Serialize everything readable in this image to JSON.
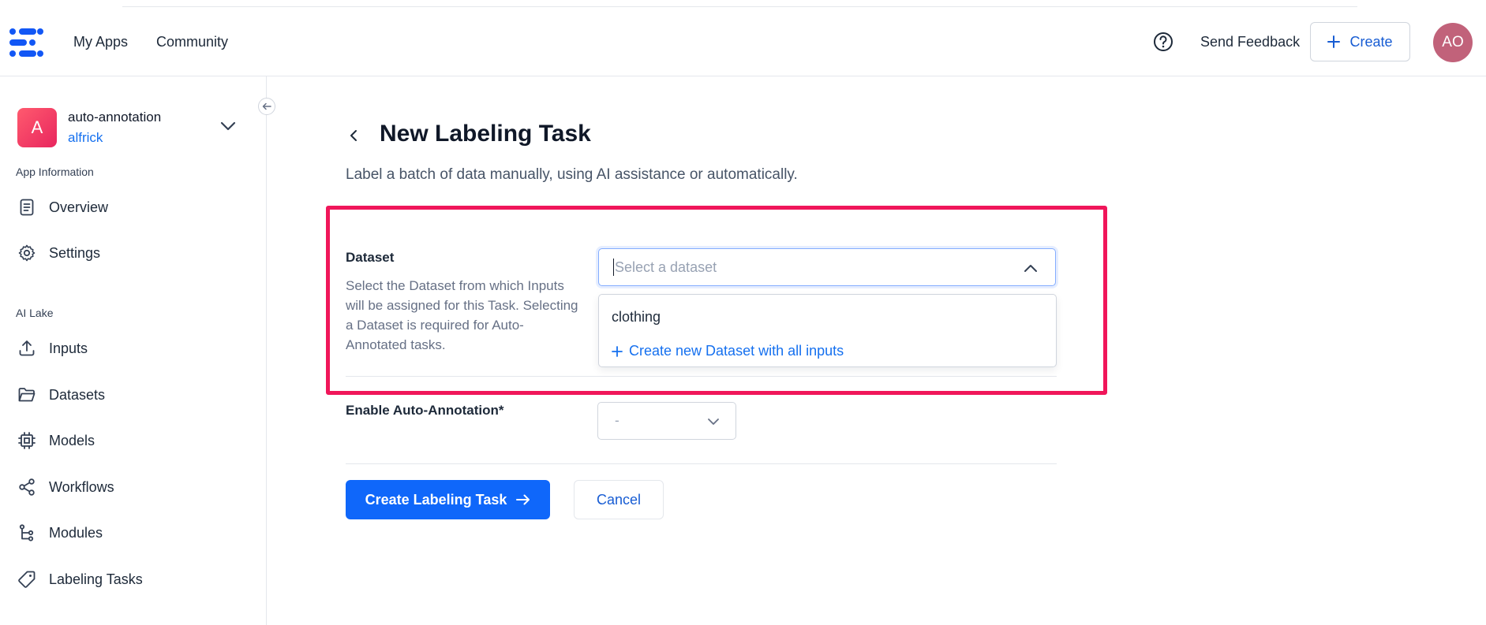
{
  "nav": {
    "links": [
      "My Apps",
      "Community"
    ],
    "send_feedback": "Send Feedback",
    "create_label": "Create",
    "avatar_initials": "AO"
  },
  "sidebar": {
    "app": {
      "badge_letter": "A",
      "name": "auto-annotation",
      "owner": "alfrick"
    },
    "sections": {
      "app_information": "App Information",
      "ai_lake": "AI Lake"
    },
    "items": [
      {
        "label": "Overview",
        "icon": "document-icon"
      },
      {
        "label": "Settings",
        "icon": "gear-icon"
      },
      {
        "label": "Inputs",
        "icon": "upload-icon"
      },
      {
        "label": "Datasets",
        "icon": "folder-icon"
      },
      {
        "label": "Models",
        "icon": "chip-icon"
      },
      {
        "label": "Workflows",
        "icon": "share-nodes-icon"
      },
      {
        "label": "Modules",
        "icon": "module-tree-icon"
      },
      {
        "label": "Labeling Tasks",
        "icon": "tag-icon"
      }
    ]
  },
  "main": {
    "title": "New Labeling Task",
    "subtitle": "Label a batch of data manually, using AI assistance or automatically.",
    "dataset": {
      "label": "Dataset",
      "help": "Select the Dataset from which Inputs will be assigned for this Task. Selecting a Dataset is required for Auto-Annotated tasks.",
      "placeholder": "Select a dataset",
      "options": [
        "clothing"
      ],
      "create_option": "Create new Dataset with all inputs"
    },
    "auto_annotation": {
      "label": "Enable Auto-Annotation*",
      "value": "-"
    },
    "actions": {
      "primary": "Create Labeling Task",
      "cancel": "Cancel"
    }
  },
  "colors": {
    "accent": "#0f67fa",
    "link": "#1570ef",
    "highlight": "#f0165a",
    "avatar": "#c1627a"
  }
}
